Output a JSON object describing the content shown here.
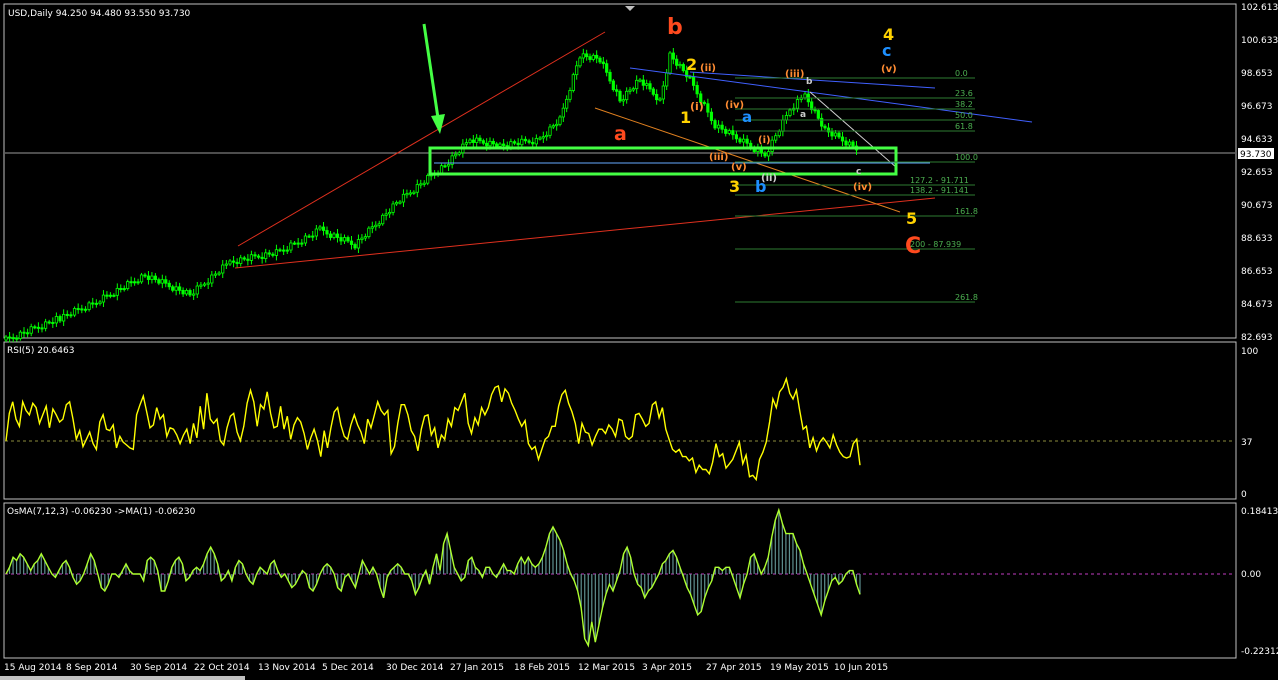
{
  "main_chart": {
    "header": "USD,Daily  94.250 94.480 93.550 93.730",
    "price_ticks": [
      "102.613",
      "100.633",
      "98.653",
      "96.673",
      "94.633",
      "92.653",
      "90.673",
      "88.633",
      "86.653",
      "84.673",
      "82.693"
    ],
    "current_price": "93.730",
    "colors": {
      "bull": "#00ff00",
      "bear": "#00ff00",
      "zone": "#44ff44",
      "arrow": "#44ff44",
      "channel": "#e0301e"
    },
    "wave_labels": [
      {
        "text": "b",
        "color": "#ff4a1e"
      },
      {
        "text": "a",
        "color": "#ff4a1e"
      },
      {
        "text": "2",
        "color": "#ffd200"
      },
      {
        "text": "(i)",
        "color": "#ff8c32"
      },
      {
        "text": "(ii)",
        "color": "#ff8c32"
      },
      {
        "text": "1",
        "color": "#ffd200"
      },
      {
        "text": "(iv)",
        "color": "#ff8c32"
      },
      {
        "text": "(iii)",
        "color": "#ff8c32"
      },
      {
        "text": "a",
        "color": "#1e90ff"
      },
      {
        "text": "b",
        "color": "#cccccc"
      },
      {
        "text": "a",
        "color": "#cccccc"
      },
      {
        "text": "(i)",
        "color": "#ff8c32"
      },
      {
        "text": "(iii)",
        "color": "#ff8c32"
      },
      {
        "text": "(v)",
        "color": "#ff8c32"
      },
      {
        "text": "(ii)",
        "color": "#cccccc"
      },
      {
        "text": "3",
        "color": "#ffd200"
      },
      {
        "text": "b",
        "color": "#1e90ff"
      },
      {
        "text": "c",
        "color": "#cccccc"
      },
      {
        "text": "(iv)",
        "color": "#ff8c32"
      },
      {
        "text": "4",
        "color": "#ffd200"
      },
      {
        "text": "c",
        "color": "#1e90ff"
      },
      {
        "text": "(v)",
        "color": "#ff8c32"
      },
      {
        "text": "5",
        "color": "#ffd200"
      },
      {
        "text": "C",
        "color": "#ff4a1e"
      }
    ],
    "fib_levels": [
      "0.0",
      "23.6",
      "38.2",
      "50.0",
      "61.8",
      "100.0",
      "127.2 - 91.711",
      "138.2 - 91.141",
      "161.8",
      "200 - 87.939",
      "261.8"
    ]
  },
  "rsi": {
    "header": "RSI(5) 20.6463",
    "ticks": [
      "100",
      "37",
      "0"
    ],
    "color": "#ffff00",
    "level": 37,
    "values": [
      37,
      56,
      64,
      52,
      47,
      64,
      58,
      55,
      63,
      60,
      49,
      55,
      61,
      46,
      59,
      55,
      50,
      52,
      62,
      64,
      52,
      38,
      44,
      33,
      38,
      43,
      35,
      31,
      50,
      55,
      45,
      44,
      48,
      32,
      40,
      36,
      34,
      32,
      31,
      55,
      62,
      68,
      57,
      46,
      48,
      60,
      52,
      55,
      40,
      46,
      45,
      41,
      35,
      41,
      45,
      35,
      49,
      39,
      61,
      45,
      70,
      52,
      49,
      52,
      37,
      34,
      46,
      54,
      56,
      43,
      37,
      47,
      63,
      72,
      64,
      47,
      62,
      59,
      71,
      56,
      46,
      47,
      61,
      45,
      54,
      38,
      48,
      53,
      50,
      42,
      31,
      39,
      45,
      37,
      26,
      44,
      32,
      46,
      57,
      60,
      48,
      40,
      38,
      48,
      55,
      48,
      43,
      35,
      52,
      46,
      55,
      64,
      58,
      55,
      58,
      28,
      33,
      49,
      62,
      62,
      55,
      44,
      40,
      30,
      45,
      54,
      55,
      41,
      46,
      32,
      41,
      38,
      52,
      47,
      60,
      58,
      64,
      70,
      49,
      42,
      53,
      48,
      60,
      55,
      60,
      69,
      74,
      75,
      64,
      73,
      70,
      63,
      58,
      52,
      47,
      51,
      35,
      31,
      33,
      24,
      31,
      38,
      40,
      47,
      47,
      61,
      69,
      72,
      63,
      57,
      49,
      35,
      49,
      43,
      42,
      34,
      40,
      45,
      45,
      42,
      48,
      45,
      40,
      52,
      51,
      40,
      38,
      40,
      55,
      56,
      52,
      47,
      49,
      62,
      64,
      53,
      60,
      45,
      38,
      31,
      29,
      31,
      26,
      26,
      23,
      25,
      15,
      20,
      17,
      17,
      14,
      22,
      35,
      26,
      28,
      18,
      21,
      24,
      30,
      36,
      21,
      27,
      12,
      13,
      10,
      24,
      29,
      36,
      50,
      66,
      60,
      71,
      74,
      80,
      70,
      66,
      72,
      58,
      45,
      47,
      32,
      39,
      30,
      36,
      39,
      36,
      32,
      41,
      34,
      29,
      26,
      25,
      26,
      35,
      38,
      20
    ]
  },
  "osma": {
    "header": "OsMA(7,12,3) -0.06230  ->MA(1) -0.06230",
    "ticks": [
      "0.18413",
      "0.00",
      "-0.22312"
    ],
    "line_color": "#adff2f",
    "bar_color": "#5f8f8f",
    "zero_color": "#c03bc0",
    "values": [
      0.0,
      0.02,
      0.05,
      0.04,
      0.06,
      0.05,
      0.03,
      0.01,
      0.03,
      0.04,
      0.06,
      0.04,
      0.02,
      0.0,
      -0.01,
      0.01,
      0.03,
      0.04,
      0.02,
      -0.01,
      -0.03,
      -0.02,
      0.0,
      0.03,
      0.06,
      0.04,
      0.0,
      -0.04,
      -0.05,
      -0.03,
      0.0,
      0.0,
      -0.01,
      0.01,
      0.03,
      0.01,
      0.0,
      0.0,
      0.0,
      -0.02,
      0.04,
      0.05,
      0.04,
      0.01,
      -0.05,
      -0.05,
      -0.02,
      0.02,
      0.04,
      0.05,
      0.03,
      -0.02,
      -0.01,
      0.01,
      0.02,
      0.01,
      0.03,
      0.06,
      0.08,
      0.06,
      0.03,
      -0.02,
      -0.01,
      0.01,
      -0.02,
      0.02,
      0.04,
      0.03,
      0.0,
      -0.02,
      -0.03,
      0.0,
      0.02,
      0.01,
      0.0,
      0.03,
      0.04,
      0.01,
      -0.01,
      0.0,
      -0.02,
      -0.04,
      -0.03,
      -0.01,
      0.01,
      0.0,
      -0.04,
      -0.05,
      -0.03,
      0.0,
      0.02,
      0.03,
      0.02,
      0.0,
      -0.04,
      -0.05,
      -0.01,
      0.0,
      -0.02,
      -0.04,
      0.0,
      0.04,
      0.02,
      0.0,
      0.02,
      0.0,
      -0.04,
      -0.07,
      -0.01,
      0.01,
      0.02,
      0.03,
      0.02,
      0.0,
      0.0,
      -0.02,
      -0.06,
      -0.04,
      -0.01,
      0.01,
      -0.03,
      0.02,
      0.06,
      0.01,
      0.09,
      0.12,
      0.07,
      0.02,
      0.0,
      -0.02,
      -0.01,
      0.04,
      0.05,
      0.02,
      0.01,
      -0.01,
      0.02,
      0.02,
      0.0,
      -0.01,
      0.01,
      0.03,
      0.01,
      0.01,
      0.0,
      0.03,
      0.05,
      0.03,
      0.05,
      0.03,
      0.02,
      0.03,
      0.05,
      0.08,
      0.12,
      0.14,
      0.12,
      0.1,
      0.07,
      0.03,
      0.0,
      -0.02,
      -0.05,
      -0.1,
      -0.19,
      -0.21,
      -0.14,
      -0.2,
      -0.15,
      -0.1,
      -0.06,
      -0.03,
      -0.05,
      -0.02,
      0.01,
      0.06,
      0.08,
      0.05,
      0.0,
      -0.03,
      -0.04,
      -0.07,
      -0.05,
      -0.04,
      -0.02,
      0.0,
      0.03,
      0.04,
      0.06,
      0.07,
      0.05,
      0.02,
      -0.01,
      -0.04,
      -0.06,
      -0.09,
      -0.12,
      -0.11,
      -0.07,
      -0.04,
      -0.02,
      0.02,
      0.02,
      0.01,
      0.02,
      0.02,
      -0.01,
      -0.04,
      -0.07,
      -0.03,
      0.0,
      0.05,
      0.06,
      0.03,
      0.0,
      0.02,
      0.05,
      0.11,
      0.16,
      0.19,
      0.15,
      0.12,
      0.12,
      0.12,
      0.09,
      0.07,
      0.03,
      0.0,
      -0.03,
      -0.06,
      -0.09,
      -0.12,
      -0.08,
      -0.05,
      -0.02,
      -0.01,
      -0.03,
      -0.02,
      0.0,
      0.01,
      0.01,
      -0.03,
      -0.06
    ]
  },
  "time_axis": {
    "labels": [
      "15 Aug 2014",
      "8 Sep 2014",
      "30 Sep 2014",
      "22 Oct 2014",
      "13 Nov 2014",
      "5 Dec 2014",
      "30 Dec 2014",
      "27 Jan 2015",
      "18 Feb 2015",
      "12 Mar 2015",
      "3 Apr 2015",
      "27 Apr 2015",
      "19 May 2015",
      "10 Jun 2015"
    ]
  }
}
